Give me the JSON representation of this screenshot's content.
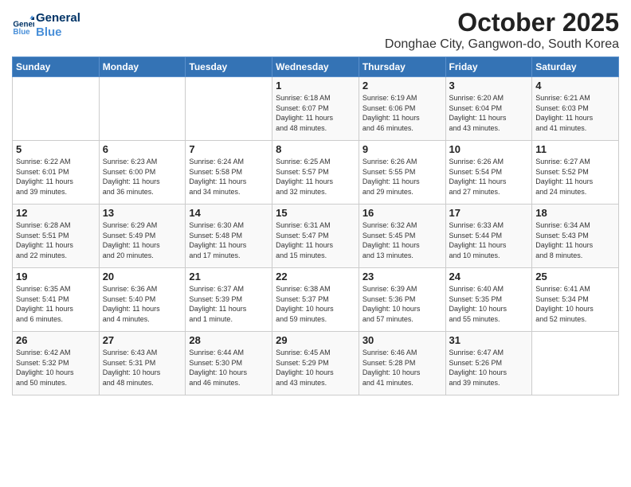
{
  "logo": {
    "line1": "General",
    "line2": "Blue"
  },
  "header": {
    "month": "October 2025",
    "location": "Donghae City, Gangwon-do, South Korea"
  },
  "weekdays": [
    "Sunday",
    "Monday",
    "Tuesday",
    "Wednesday",
    "Thursday",
    "Friday",
    "Saturday"
  ],
  "weeks": [
    [
      {
        "day": "",
        "info": ""
      },
      {
        "day": "",
        "info": ""
      },
      {
        "day": "",
        "info": ""
      },
      {
        "day": "1",
        "info": "Sunrise: 6:18 AM\nSunset: 6:07 PM\nDaylight: 11 hours\nand 48 minutes."
      },
      {
        "day": "2",
        "info": "Sunrise: 6:19 AM\nSunset: 6:06 PM\nDaylight: 11 hours\nand 46 minutes."
      },
      {
        "day": "3",
        "info": "Sunrise: 6:20 AM\nSunset: 6:04 PM\nDaylight: 11 hours\nand 43 minutes."
      },
      {
        "day": "4",
        "info": "Sunrise: 6:21 AM\nSunset: 6:03 PM\nDaylight: 11 hours\nand 41 minutes."
      }
    ],
    [
      {
        "day": "5",
        "info": "Sunrise: 6:22 AM\nSunset: 6:01 PM\nDaylight: 11 hours\nand 39 minutes."
      },
      {
        "day": "6",
        "info": "Sunrise: 6:23 AM\nSunset: 6:00 PM\nDaylight: 11 hours\nand 36 minutes."
      },
      {
        "day": "7",
        "info": "Sunrise: 6:24 AM\nSunset: 5:58 PM\nDaylight: 11 hours\nand 34 minutes."
      },
      {
        "day": "8",
        "info": "Sunrise: 6:25 AM\nSunset: 5:57 PM\nDaylight: 11 hours\nand 32 minutes."
      },
      {
        "day": "9",
        "info": "Sunrise: 6:26 AM\nSunset: 5:55 PM\nDaylight: 11 hours\nand 29 minutes."
      },
      {
        "day": "10",
        "info": "Sunrise: 6:26 AM\nSunset: 5:54 PM\nDaylight: 11 hours\nand 27 minutes."
      },
      {
        "day": "11",
        "info": "Sunrise: 6:27 AM\nSunset: 5:52 PM\nDaylight: 11 hours\nand 24 minutes."
      }
    ],
    [
      {
        "day": "12",
        "info": "Sunrise: 6:28 AM\nSunset: 5:51 PM\nDaylight: 11 hours\nand 22 minutes."
      },
      {
        "day": "13",
        "info": "Sunrise: 6:29 AM\nSunset: 5:49 PM\nDaylight: 11 hours\nand 20 minutes."
      },
      {
        "day": "14",
        "info": "Sunrise: 6:30 AM\nSunset: 5:48 PM\nDaylight: 11 hours\nand 17 minutes."
      },
      {
        "day": "15",
        "info": "Sunrise: 6:31 AM\nSunset: 5:47 PM\nDaylight: 11 hours\nand 15 minutes."
      },
      {
        "day": "16",
        "info": "Sunrise: 6:32 AM\nSunset: 5:45 PM\nDaylight: 11 hours\nand 13 minutes."
      },
      {
        "day": "17",
        "info": "Sunrise: 6:33 AM\nSunset: 5:44 PM\nDaylight: 11 hours\nand 10 minutes."
      },
      {
        "day": "18",
        "info": "Sunrise: 6:34 AM\nSunset: 5:43 PM\nDaylight: 11 hours\nand 8 minutes."
      }
    ],
    [
      {
        "day": "19",
        "info": "Sunrise: 6:35 AM\nSunset: 5:41 PM\nDaylight: 11 hours\nand 6 minutes."
      },
      {
        "day": "20",
        "info": "Sunrise: 6:36 AM\nSunset: 5:40 PM\nDaylight: 11 hours\nand 4 minutes."
      },
      {
        "day": "21",
        "info": "Sunrise: 6:37 AM\nSunset: 5:39 PM\nDaylight: 11 hours\nand 1 minute."
      },
      {
        "day": "22",
        "info": "Sunrise: 6:38 AM\nSunset: 5:37 PM\nDaylight: 10 hours\nand 59 minutes."
      },
      {
        "day": "23",
        "info": "Sunrise: 6:39 AM\nSunset: 5:36 PM\nDaylight: 10 hours\nand 57 minutes."
      },
      {
        "day": "24",
        "info": "Sunrise: 6:40 AM\nSunset: 5:35 PM\nDaylight: 10 hours\nand 55 minutes."
      },
      {
        "day": "25",
        "info": "Sunrise: 6:41 AM\nSunset: 5:34 PM\nDaylight: 10 hours\nand 52 minutes."
      }
    ],
    [
      {
        "day": "26",
        "info": "Sunrise: 6:42 AM\nSunset: 5:32 PM\nDaylight: 10 hours\nand 50 minutes."
      },
      {
        "day": "27",
        "info": "Sunrise: 6:43 AM\nSunset: 5:31 PM\nDaylight: 10 hours\nand 48 minutes."
      },
      {
        "day": "28",
        "info": "Sunrise: 6:44 AM\nSunset: 5:30 PM\nDaylight: 10 hours\nand 46 minutes."
      },
      {
        "day": "29",
        "info": "Sunrise: 6:45 AM\nSunset: 5:29 PM\nDaylight: 10 hours\nand 43 minutes."
      },
      {
        "day": "30",
        "info": "Sunrise: 6:46 AM\nSunset: 5:28 PM\nDaylight: 10 hours\nand 41 minutes."
      },
      {
        "day": "31",
        "info": "Sunrise: 6:47 AM\nSunset: 5:26 PM\nDaylight: 10 hours\nand 39 minutes."
      },
      {
        "day": "",
        "info": ""
      }
    ]
  ]
}
